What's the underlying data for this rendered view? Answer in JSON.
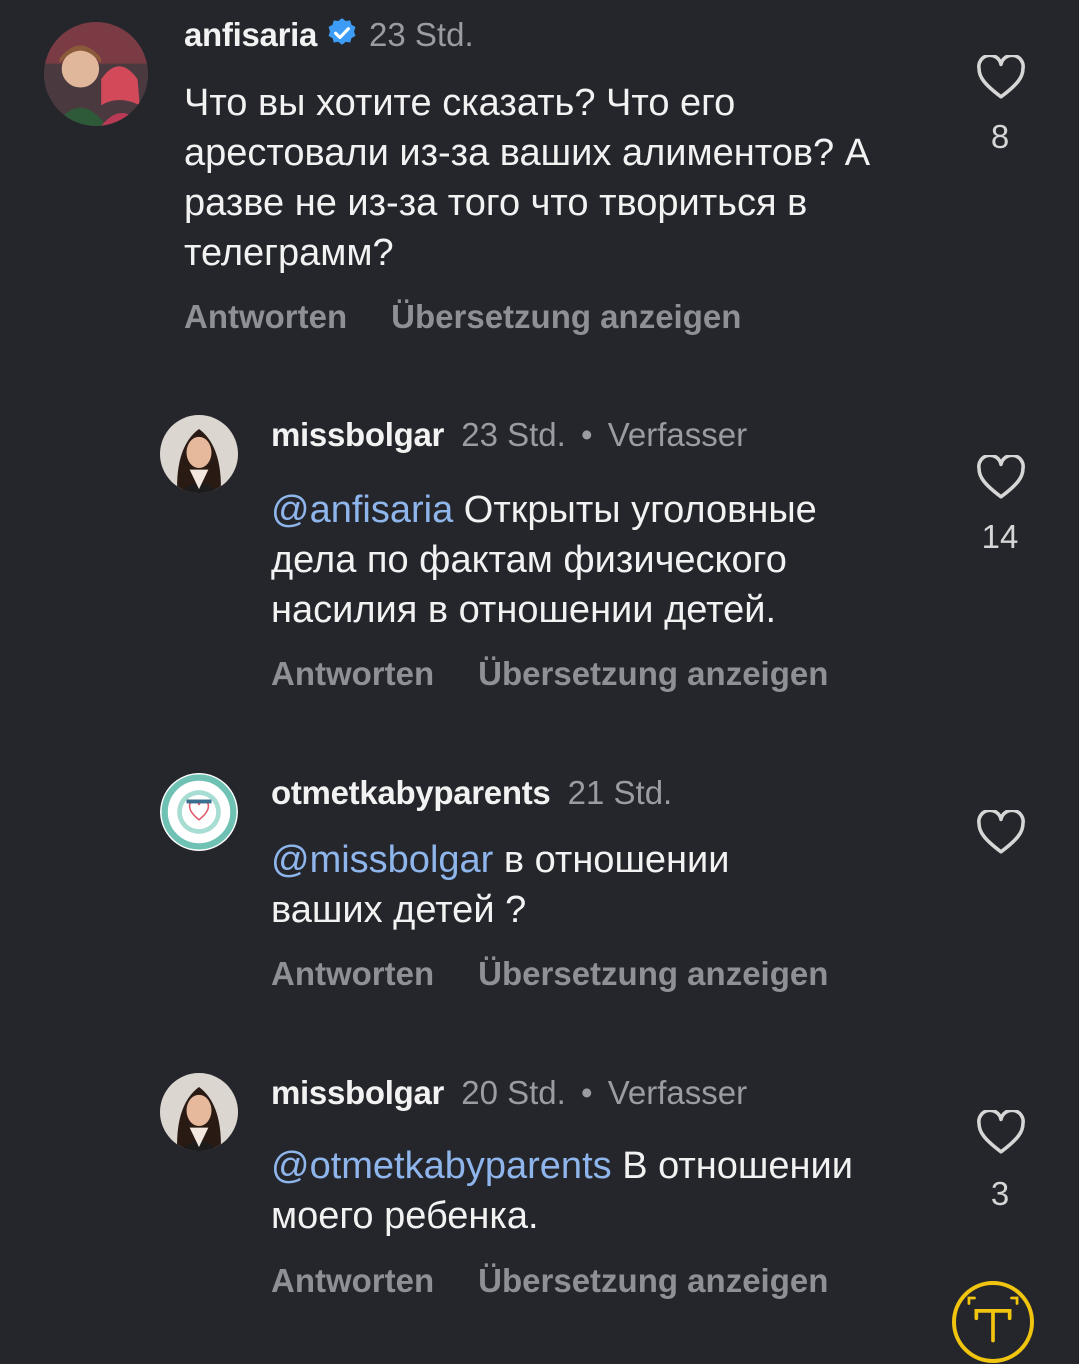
{
  "comments": [
    {
      "username": "anfisaria",
      "verified": true,
      "time": "23 Std.",
      "author_tag": "",
      "mention": "",
      "text": "Что вы хотите сказать? Что его арестовали из-за ваших алиментов? А разве не из-за того что твориться в телеграмм?",
      "likes": "8",
      "reply": "Antworten",
      "translate": "Übersetzung anzeigen"
    },
    {
      "username": "missbolgar",
      "verified": false,
      "time": "23 Std.",
      "author_tag": "Verfasser",
      "mention": "@anfisaria",
      "text": "Открыты уголовные дела по фактам физического насилия в отношении детей.",
      "likes": "14",
      "reply": "Antworten",
      "translate": "Übersetzung anzeigen"
    },
    {
      "username": "otmetkabyparents",
      "verified": false,
      "time": "21 Std.",
      "author_tag": "",
      "mention": "@missbolgar",
      "text": "в отношении ваших детей ?",
      "likes": "",
      "reply": "Antworten",
      "translate": "Übersetzung anzeigen"
    },
    {
      "username": "missbolgar",
      "verified": false,
      "time": "20 Std.",
      "author_tag": "Verfasser",
      "mention": "@otmetkabyparents",
      "text": "В отношении моего ребенка.",
      "likes": "3",
      "reply": "Antworten",
      "translate": "Übersetzung anzeigen"
    }
  ],
  "separator": "•",
  "icons": {
    "like": "heart-outline-icon",
    "verified": "verified-badge-icon",
    "fab": "translate-text-icon"
  },
  "colors": {
    "background": "#24262b",
    "mention": "#8fb6ec",
    "verified": "#3d9df6",
    "fab_ring": "#f1c40f"
  }
}
